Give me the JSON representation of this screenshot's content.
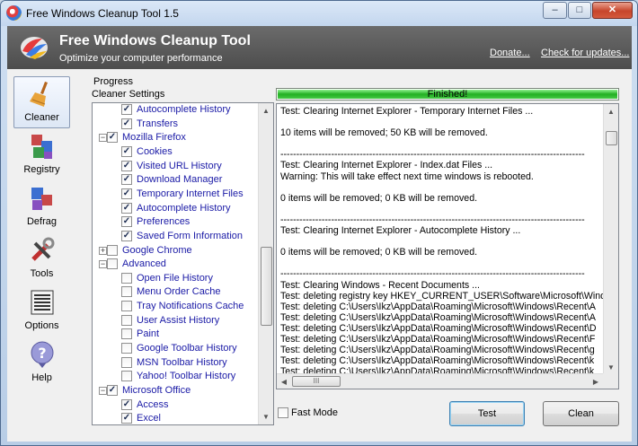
{
  "window": {
    "title": "Free Windows Cleanup Tool 1.5",
    "controls": {
      "minimize": "–",
      "maximize": "□",
      "close": "✕"
    }
  },
  "banner": {
    "title": "Free Windows Cleanup Tool",
    "subtitle": "Optimize your computer performance",
    "links": {
      "donate": "Donate...",
      "updates": "Check for updates..."
    }
  },
  "sidebar": {
    "items": [
      {
        "label": "Cleaner",
        "icon": "broom-icon",
        "active": true
      },
      {
        "label": "Registry",
        "icon": "registry-cubes-icon",
        "active": false
      },
      {
        "label": "Defrag",
        "icon": "defrag-cubes-icon",
        "active": false
      },
      {
        "label": "Tools",
        "icon": "tools-icon",
        "active": false
      },
      {
        "label": "Options",
        "icon": "options-list-icon",
        "active": false
      },
      {
        "label": "Help",
        "icon": "help-icon",
        "active": false
      }
    ]
  },
  "labels": {
    "progress": "Progress",
    "cleaner_settings": "Cleaner Settings"
  },
  "tree": [
    {
      "label": "Autocomplete History",
      "level": 2,
      "checked": true
    },
    {
      "label": "Transfers",
      "level": 2,
      "checked": true
    },
    {
      "label": "Mozilla Firefox",
      "level": 1,
      "checked": true,
      "expander": "minus"
    },
    {
      "label": "Cookies",
      "level": 2,
      "checked": true
    },
    {
      "label": "Visited URL History",
      "level": 2,
      "checked": true
    },
    {
      "label": "Download Manager",
      "level": 2,
      "checked": true
    },
    {
      "label": "Temporary Internet Files",
      "level": 2,
      "checked": true
    },
    {
      "label": "Autocomplete History",
      "level": 2,
      "checked": true
    },
    {
      "label": "Preferences",
      "level": 2,
      "checked": true
    },
    {
      "label": "Saved Form Information",
      "level": 2,
      "checked": true
    },
    {
      "label": "Google Chrome",
      "level": 1,
      "checked": false,
      "expander": "plus"
    },
    {
      "label": "Advanced",
      "level": 1,
      "checked": false,
      "expander": "minus"
    },
    {
      "label": "Open File History",
      "level": 2,
      "checked": false
    },
    {
      "label": "Menu Order Cache",
      "level": 2,
      "checked": false
    },
    {
      "label": "Tray Notifications Cache",
      "level": 2,
      "checked": false
    },
    {
      "label": "User Assist History",
      "level": 2,
      "checked": false
    },
    {
      "label": "Paint",
      "level": 2,
      "checked": false
    },
    {
      "label": "Google Toolbar History",
      "level": 2,
      "checked": false
    },
    {
      "label": "MSN Toolbar History",
      "level": 2,
      "checked": false
    },
    {
      "label": "Yahoo! Toolbar History",
      "level": 2,
      "checked": false
    },
    {
      "label": "Microsoft Office",
      "level": 1,
      "checked": true,
      "expander": "minus"
    },
    {
      "label": "Access",
      "level": 2,
      "checked": true
    },
    {
      "label": "Excel",
      "level": 2,
      "checked": true
    }
  ],
  "progress": {
    "percent": 100,
    "text": "Finished!"
  },
  "log": {
    "lines": [
      "Test: Clearing Internet Explorer - Temporary Internet Files ...",
      "",
      "10 items will be removed; 50 KB will be removed.",
      "",
      "------------------------------------------------------------------------------------------------",
      "Test: Clearing Internet Explorer - Index.dat Files ...",
      "Warning: This will take effect next time windows is rebooted.",
      "",
      "0 items will be removed; 0 KB will be removed.",
      "",
      "------------------------------------------------------------------------------------------------",
      "Test: Clearing Internet Explorer - Autocomplete History ...",
      "",
      "0 items will be removed; 0 KB will be removed.",
      "",
      "------------------------------------------------------------------------------------------------",
      "Test: Clearing Windows - Recent Documents ...",
      "Test: deleting registry key HKEY_CURRENT_USER\\Software\\Microsoft\\Windo",
      "Test: deleting C:\\Users\\Ikz\\AppData\\Roaming\\Microsoft\\Windows\\Recent\\A",
      "Test: deleting C:\\Users\\Ikz\\AppData\\Roaming\\Microsoft\\Windows\\Recent\\A",
      "Test: deleting C:\\Users\\Ikz\\AppData\\Roaming\\Microsoft\\Windows\\Recent\\D",
      "Test: deleting C:\\Users\\Ikz\\AppData\\Roaming\\Microsoft\\Windows\\Recent\\F",
      "Test: deleting C:\\Users\\Ikz\\AppData\\Roaming\\Microsoft\\Windows\\Recent\\g",
      "Test: deleting C:\\Users\\Ikz\\AppData\\Roaming\\Microsoft\\Windows\\Recent\\k",
      "Test: deleting C:\\Users\\Ikz\\AppData\\Roaming\\Microsoft\\Windows\\Recent\\k"
    ]
  },
  "fast_mode": {
    "label": "Fast Mode",
    "checked": false
  },
  "buttons": {
    "test": "Test",
    "clean": "Clean"
  },
  "colors": {
    "banner": "#5a5a5a",
    "progress": "#2ab52a",
    "tree_link": "#1a1aa6"
  }
}
